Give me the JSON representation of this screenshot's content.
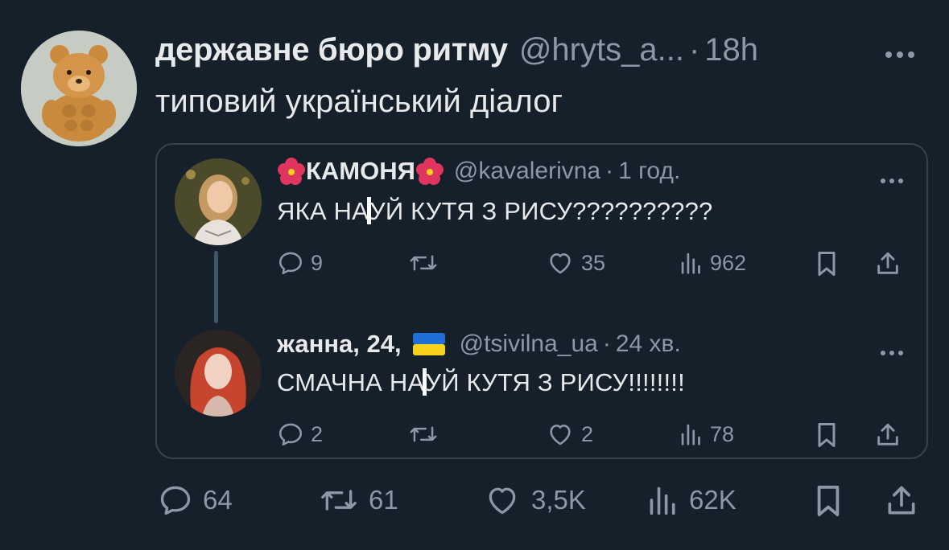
{
  "tweet": {
    "author_name": "державне бюро ритму",
    "handle": "@hryts_a...",
    "separator": "·",
    "time": "18h",
    "text": "типовий український діалог",
    "more_icon": "more-horizontal-icon",
    "actions": {
      "replies": "64",
      "retweets": "61",
      "likes": "3,5K",
      "views": "62K"
    }
  },
  "quote": {
    "posts": [
      {
        "name": "КАМОНЯ",
        "name_decoration": "hibiscus-icon",
        "handle": "@kavalerivna",
        "separator": "·",
        "time": "1 год.",
        "text_before": "ЯКА НА",
        "text_after": "УЙ КУТЯ З РИСУ??????????",
        "actions": {
          "replies": "9",
          "retweets": "",
          "likes": "35",
          "views": "962"
        }
      },
      {
        "name": "жанна, 24,",
        "name_decoration": "ukraine-flag-icon",
        "handle": "@tsivilna_ua",
        "separator": "·",
        "time": "24 хв.",
        "text_before": "СМАЧНА НА",
        "text_after": "УЙ КУТЯ З РИСУ!!!!!!!!",
        "actions": {
          "replies": "2",
          "retweets": "",
          "likes": "2",
          "views": "78"
        }
      }
    ]
  },
  "colors": {
    "background": "#15202b",
    "text_primary": "#e7e9ea",
    "text_secondary": "#8b98a5",
    "border": "#38444d",
    "flag_blue": "#1f6fd6",
    "flag_yellow": "#f7d21c",
    "hibiscus": "#e0355f"
  }
}
